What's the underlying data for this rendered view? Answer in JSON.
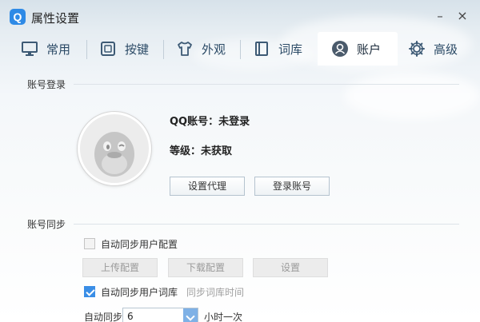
{
  "window": {
    "title": "属性设置",
    "logo_letter": "Q",
    "minimize": "–",
    "close": "×"
  },
  "tabs": [
    {
      "label": "常用",
      "icon": "monitor-icon"
    },
    {
      "label": "按键",
      "icon": "keyboard-icon"
    },
    {
      "label": "外观",
      "icon": "tshirt-icon"
    },
    {
      "label": "词库",
      "icon": "book-icon"
    },
    {
      "label": "账户",
      "icon": "user-icon",
      "active": true
    },
    {
      "label": "高级",
      "icon": "gear-icon"
    }
  ],
  "account_login": {
    "section_title": "账号登录",
    "qq_account": "QQ账号：未登录",
    "level": "等级：未获取",
    "proxy_button": "设置代理",
    "login_button": "登录账号"
  },
  "account_sync": {
    "section_title": "账号同步",
    "sync_config_label": "自动同步用户配置",
    "sync_config_checked": false,
    "upload_button": "上传配置",
    "download_button": "下载配置",
    "settings_button": "设置",
    "sync_lexicon_label": "自动同步用户词库",
    "sync_lexicon_checked": true,
    "sync_time_label": "同步词库时间",
    "auto_sync_label": "自动同步",
    "interval_value": "6",
    "interval_suffix": "小时一次"
  },
  "colors": {
    "accent": "#2e8ae6",
    "checked": "#3a8ee6",
    "tab_text": "#2b4a66"
  }
}
